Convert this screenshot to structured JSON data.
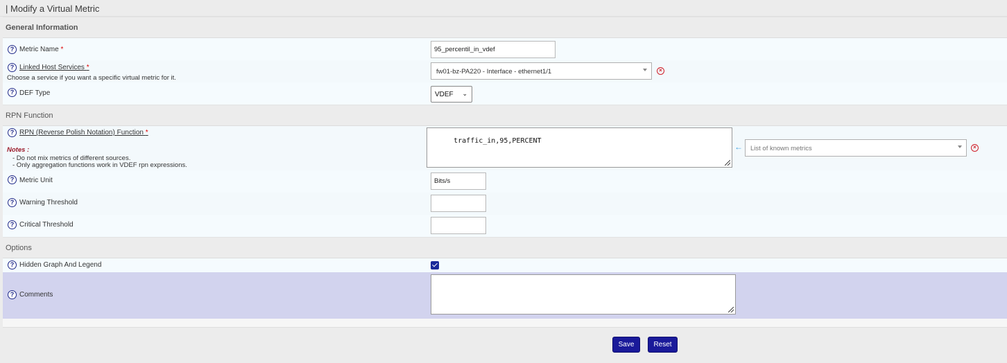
{
  "page_title": "| Modify a Virtual Metric",
  "sections": {
    "general": "General Information",
    "rpn": "RPN Function",
    "options": "Options"
  },
  "help_icon_glyph": "?",
  "required_mark": "*",
  "fields": {
    "metric_name": {
      "label": "Metric Name",
      "value": "95_percentil_in_vdef"
    },
    "linked_host": {
      "label": "Linked Host Services",
      "hint": "Choose a service if you want a specific virtual metric for it.",
      "value": "fw01-bz-PA220 - Interface - ethernet1/1"
    },
    "def_type": {
      "label": "DEF Type",
      "value": "VDEF"
    },
    "rpn_function": {
      "label": "RPN (Reverse Polish Notation) Function",
      "value": "traffic_in,95,PERCENT",
      "notes_title": "Notes :",
      "notes": [
        "- Do not mix metrics of different sources.",
        "- Only aggregation functions work in VDEF rpn expressions."
      ],
      "known_metrics_placeholder": "List of known metrics"
    },
    "metric_unit": {
      "label": "Metric Unit",
      "value": "Bits/s"
    },
    "warning_threshold": {
      "label": "Warning Threshold",
      "value": ""
    },
    "critical_threshold": {
      "label": "Critical Threshold",
      "value": ""
    },
    "hidden_graph": {
      "label": "Hidden Graph And Legend",
      "checked": true
    },
    "comments": {
      "label": "Comments",
      "value": ""
    }
  },
  "buttons": {
    "save": "Save",
    "reset": "Reset"
  },
  "colors": {
    "button": "#1a1a9a",
    "required": "#dd0000",
    "notes": "#9b1b2a",
    "highlight_row": "#d2d3ee"
  }
}
